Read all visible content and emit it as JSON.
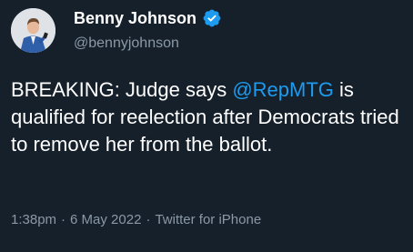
{
  "author": {
    "display_name": "Benny Johnson",
    "handle": "@bennyjohnson",
    "verified": true,
    "avatar_icon": "profile-photo"
  },
  "tweet": {
    "text_before": "BREAKING: Judge says ",
    "mention": "@RepMTG",
    "text_after": " is qualified for reelection after Democrats tried to remove her from the ballot."
  },
  "meta": {
    "time": "1:38pm",
    "separator": "·",
    "date": "6 May 2022",
    "source": "Twitter for iPhone"
  },
  "colors": {
    "background": "#15202b",
    "text": "#ffffff",
    "secondary": "#8b98a5",
    "accent": "#1d9bf0"
  }
}
